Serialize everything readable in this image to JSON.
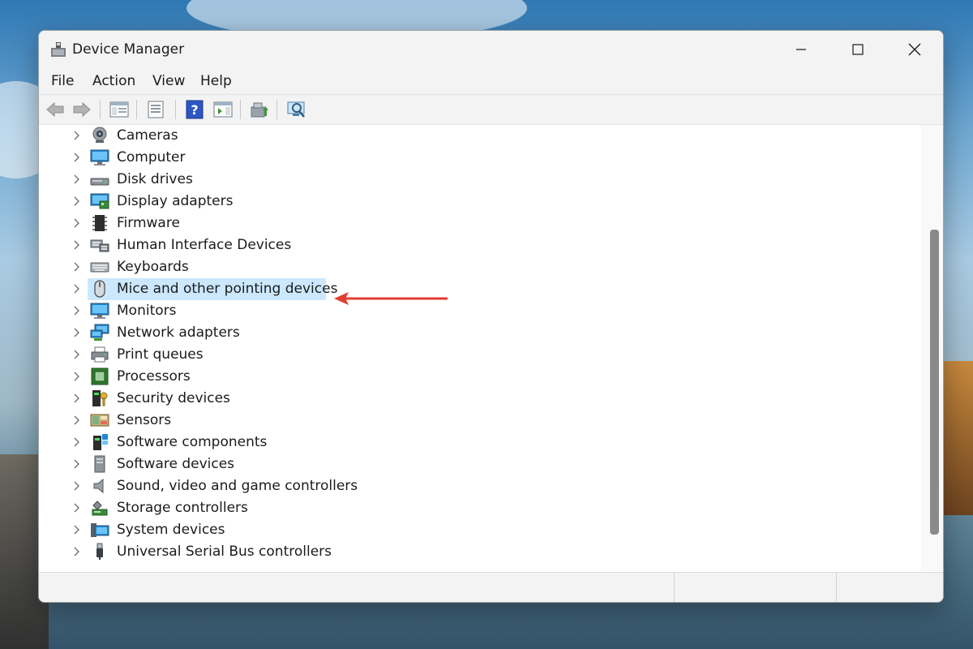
{
  "window": {
    "title": "Device Manager"
  },
  "menu": {
    "file": "File",
    "action": "Action",
    "view": "View",
    "help": "Help"
  },
  "toolbar": {
    "icons": [
      "back-arrow-icon",
      "forward-arrow-icon",
      "show-hide-console-tree-icon",
      "properties-icon",
      "help-icon",
      "show-action-pane-icon",
      "update-driver-icon",
      "scan-hardware-icon"
    ]
  },
  "tree": {
    "selected_item": "Mice and other pointing devices",
    "items": [
      {
        "label": "Cameras",
        "icon": "camera-icon"
      },
      {
        "label": "Computer",
        "icon": "computer-icon"
      },
      {
        "label": "Disk drives",
        "icon": "disk-drive-icon"
      },
      {
        "label": "Display adapters",
        "icon": "display-adapter-icon"
      },
      {
        "label": "Firmware",
        "icon": "firmware-icon"
      },
      {
        "label": "Human Interface Devices",
        "icon": "hid-icon"
      },
      {
        "label": "Keyboards",
        "icon": "keyboard-icon"
      },
      {
        "label": "Mice and other pointing devices",
        "icon": "mouse-icon"
      },
      {
        "label": "Monitors",
        "icon": "monitor-icon"
      },
      {
        "label": "Network adapters",
        "icon": "network-adapter-icon"
      },
      {
        "label": "Print queues",
        "icon": "printer-icon"
      },
      {
        "label": "Processors",
        "icon": "processor-icon"
      },
      {
        "label": "Security devices",
        "icon": "security-device-icon"
      },
      {
        "label": "Sensors",
        "icon": "sensor-icon"
      },
      {
        "label": "Software components",
        "icon": "software-component-icon"
      },
      {
        "label": "Software devices",
        "icon": "software-device-icon"
      },
      {
        "label": "Sound, video and game controllers",
        "icon": "speaker-icon"
      },
      {
        "label": "Storage controllers",
        "icon": "storage-controller-icon"
      },
      {
        "label": "System devices",
        "icon": "system-device-icon"
      },
      {
        "label": "Universal Serial Bus controllers",
        "icon": "usb-icon"
      }
    ]
  },
  "colors": {
    "selection": "#cce8ff",
    "annotation_arrow": "#e03c31",
    "window_chrome": "#f3f3f3"
  }
}
